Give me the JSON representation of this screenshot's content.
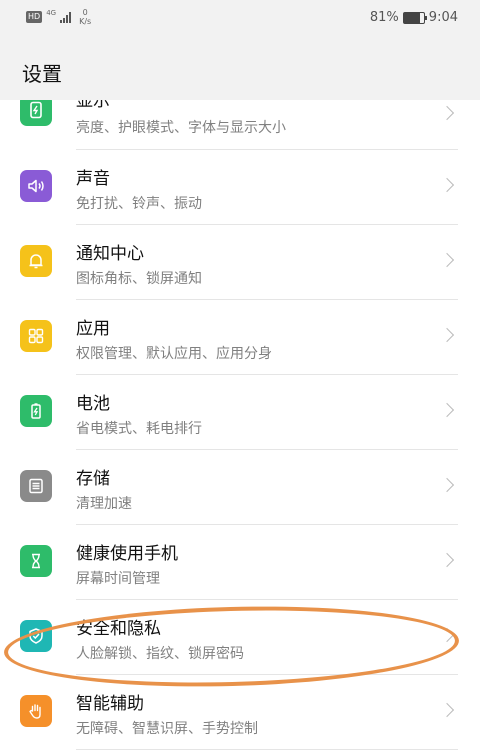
{
  "statusbar": {
    "hd": "HD",
    "network": "4G",
    "speed_value": "0",
    "speed_unit": "K/s",
    "battery": "81%",
    "time": "9:04",
    "battery_level_percent": 81
  },
  "header": {
    "title": "设置"
  },
  "items": [
    {
      "title": "显示",
      "subtitle": "亮度、护眼模式、字体与显示大小",
      "icon": "display-icon",
      "color": "#2ebc6a"
    },
    {
      "title": "声音",
      "subtitle": "免打扰、铃声、振动",
      "icon": "sound-icon",
      "color": "#8a5bd6"
    },
    {
      "title": "通知中心",
      "subtitle": "图标角标、锁屏通知",
      "icon": "bell-icon",
      "color": "#f5c21a"
    },
    {
      "title": "应用",
      "subtitle": "权限管理、默认应用、应用分身",
      "icon": "apps-icon",
      "color": "#f5c21a"
    },
    {
      "title": "电池",
      "subtitle": "省电模式、耗电排行",
      "icon": "battery-icon",
      "color": "#2ebc6a"
    },
    {
      "title": "存储",
      "subtitle": "清理加速",
      "icon": "storage-icon",
      "color": "#8a8a8a"
    },
    {
      "title": "健康使用手机",
      "subtitle": "屏幕时间管理",
      "icon": "hourglass-icon",
      "color": "#2ebc6a"
    },
    {
      "title": "安全和隐私",
      "subtitle": "人脸解锁、指纹、锁屏密码",
      "icon": "shield-icon",
      "color": "#1fb7b4"
    },
    {
      "title": "智能辅助",
      "subtitle": "无障碍、智慧识屏、手势控制",
      "icon": "hand-icon",
      "color": "#f5902a"
    }
  ]
}
